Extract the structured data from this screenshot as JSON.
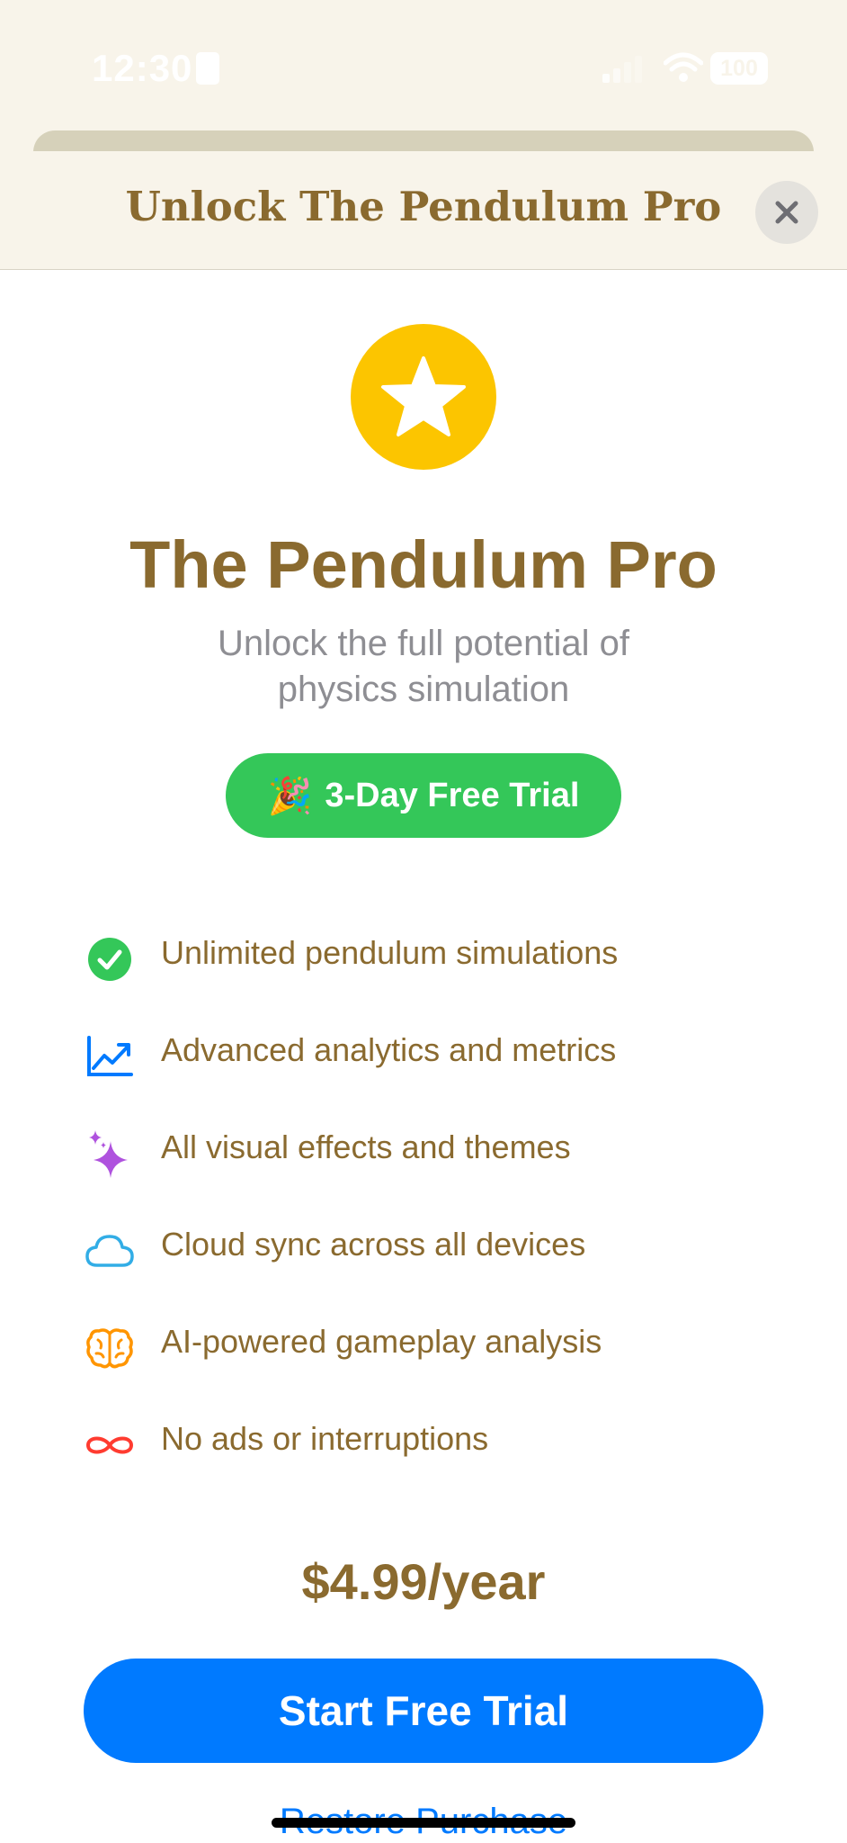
{
  "status_bar": {
    "time": "12:30",
    "battery": "100"
  },
  "header": {
    "title": "Unlock The Pendulum Pro",
    "close_icon": "xmark"
  },
  "hero": {
    "icon": "star-fill",
    "title": "The Pendulum Pro",
    "subtitle": "Unlock the full potential of physics simulation"
  },
  "trial_badge": {
    "emoji": "🎉",
    "label": "3-Day Free Trial"
  },
  "features": [
    {
      "icon": "checkmark-circle-fill",
      "text": "Unlimited pendulum simulations",
      "color": "#34c759"
    },
    {
      "icon": "chart-line-uptrend",
      "text": "Advanced analytics and metrics",
      "color": "#007aff"
    },
    {
      "icon": "sparkles",
      "text": "All visual effects and themes",
      "color": "#af52de"
    },
    {
      "icon": "cloud",
      "text": "Cloud sync across all devices",
      "color": "#32ade6"
    },
    {
      "icon": "brain",
      "text": "AI-powered gameplay analysis",
      "color": "#ff9500"
    },
    {
      "icon": "infinity",
      "text": "No ads or interruptions",
      "color": "#ff3b30"
    }
  ],
  "price": "$4.99/year",
  "cta_label": "Start Free Trial",
  "restore_label": "Restore Purchase",
  "colors": {
    "accent_text": "#8a6a2f",
    "primary_blue": "#007aff",
    "trial_green": "#34c759",
    "star_yellow": "#fcc500",
    "header_bg": "#f8f4ea"
  }
}
